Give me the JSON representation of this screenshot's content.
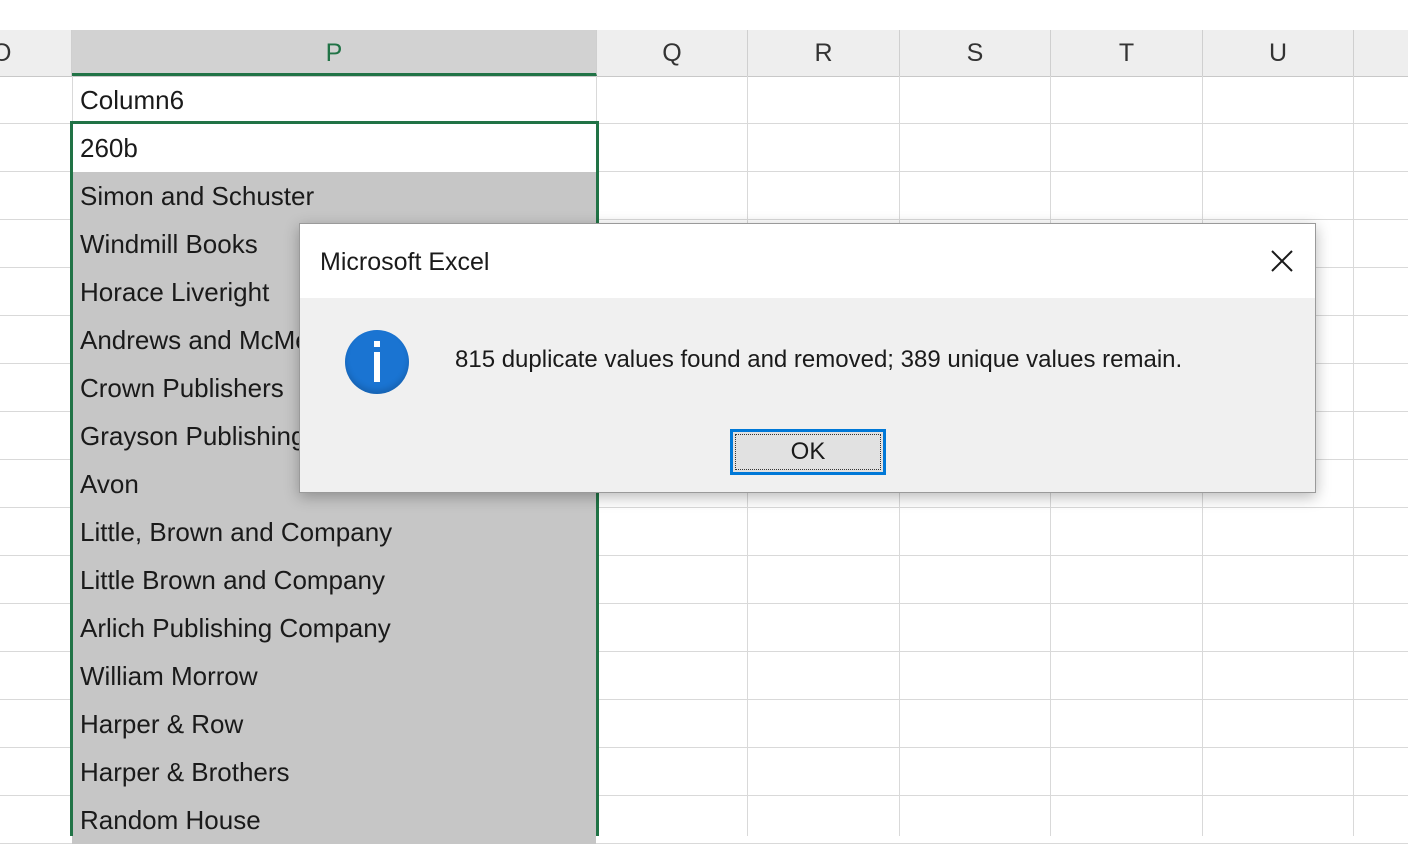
{
  "columns": {
    "partial_o": "O",
    "p": "P",
    "q": "Q",
    "r": "R",
    "s": "S",
    "t": "T",
    "u": "U"
  },
  "column_p_cells": [
    "Column6",
    "260b",
    "Simon and Schuster",
    "Windmill Books",
    "Horace Liveright",
    "Andrews and McMeel",
    "Crown Publishers",
    "Grayson Publishing",
    "Avon",
    "Little, Brown and Company",
    "Little Brown and Company",
    "Arlich Publishing Company",
    "William Morrow",
    "Harper & Row",
    "Harper & Brothers",
    "Random House"
  ],
  "dialog": {
    "title": "Microsoft Excel",
    "message": "815 duplicate values found and removed; 389 unique values remain.",
    "ok_label": "OK",
    "icon": "info-icon",
    "accent_color": "#0078d7",
    "info_color": "#1a74d2"
  },
  "selection_color": "#217346"
}
